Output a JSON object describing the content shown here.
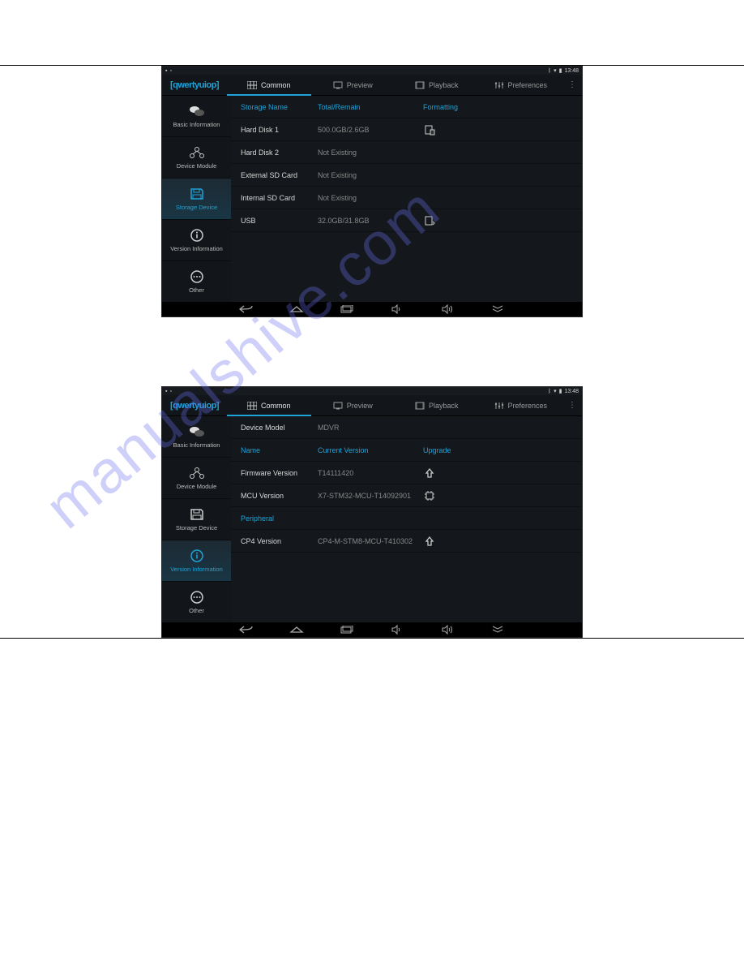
{
  "status": {
    "time": "13:48"
  },
  "logo": "qwertyuiop",
  "tabs": {
    "common": "Common",
    "preview": "Preview",
    "playback": "Playback",
    "preferences": "Preferences"
  },
  "sidebar": {
    "basic": "Basic Information",
    "module": "Device Module",
    "storage": "Storage Device",
    "version": "Version Information",
    "other": "Other"
  },
  "s1": {
    "h_name": "Storage Name",
    "h_total": "Total/Remain",
    "h_fmt": "Formatting",
    "rows": [
      {
        "name": "Hard Disk 1",
        "val": "500.0GB/2.6GB",
        "icon": true
      },
      {
        "name": "Hard Disk 2",
        "val": "Not Existing",
        "icon": false
      },
      {
        "name": "External SD Card",
        "val": "Not Existing",
        "icon": false
      },
      {
        "name": "Internal SD Card",
        "val": "Not Existing",
        "icon": false
      },
      {
        "name": "USB",
        "val": "32.0GB/31.8GB",
        "icon": true
      }
    ]
  },
  "s2": {
    "model_label": "Device Model",
    "model_value": "MDVR",
    "h_name": "Name",
    "h_ver": "Current Version",
    "h_upg": "Upgrade",
    "rows": [
      {
        "name": "Firmware Version",
        "val": "T14111420",
        "icon": "up"
      },
      {
        "name": "MCU Version",
        "val": "X7-STM32-MCU-T14092901",
        "icon": "chip"
      }
    ],
    "periph": "Peripheral",
    "rows2": [
      {
        "name": "CP4 Version",
        "val": "CP4-M-STM8-MCU-T410302",
        "icon": "up"
      }
    ]
  },
  "watermark": "manualshive.com"
}
